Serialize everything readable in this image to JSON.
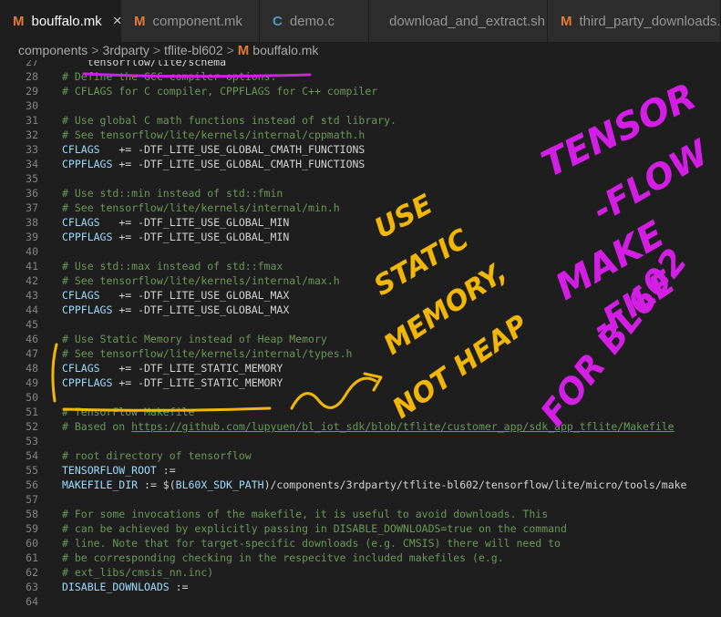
{
  "tabs": [
    {
      "label": "bouffalo.mk",
      "icon": "makefile-icon",
      "active": true
    },
    {
      "label": "component.mk",
      "icon": "makefile-icon"
    },
    {
      "label": "demo.c",
      "icon": "c-file-icon"
    },
    {
      "label": "download_and_extract.sh",
      "icon": "shell-file-icon"
    },
    {
      "label": "third_party_downloads.inc",
      "icon": "makefile-icon"
    }
  ],
  "tab_close": "×",
  "icon_m": "M",
  "icon_c": "C",
  "breadcrumb": {
    "parts": [
      "components",
      "3rdparty",
      "tflite-bl602",
      "bouffalo.mk"
    ],
    "sep": ">"
  },
  "colors": {
    "annotation_purple": "#d41ee6",
    "annotation_yellow": "#f2b705",
    "comment": "#6a9955",
    "variable": "#9cdcfe"
  },
  "code_lines": [
    {
      "n": "27",
      "segs": [
        {
          "t": "    tensorflow/lite/schema",
          "c": "plain"
        }
      ]
    },
    {
      "n": "28",
      "segs": [
        {
          "t": "# Define the GCC compiler options:",
          "c": "comment"
        }
      ]
    },
    {
      "n": "29",
      "segs": [
        {
          "t": "# CFLAGS for C compiler, CPPFLAGS for C++ compiler",
          "c": "comment"
        }
      ]
    },
    {
      "n": "30",
      "segs": []
    },
    {
      "n": "31",
      "segs": [
        {
          "t": "# Use global C math functions instead of std library.",
          "c": "comment"
        }
      ]
    },
    {
      "n": "32",
      "segs": [
        {
          "t": "# See tensorflow/lite/kernels/internal/cppmath.h",
          "c": "comment"
        }
      ]
    },
    {
      "n": "33",
      "segs": [
        {
          "t": "CFLAGS",
          "c": "var"
        },
        {
          "t": "   += -DTF_LITE_USE_GLOBAL_CMATH_FUNCTIONS",
          "c": "plain"
        }
      ]
    },
    {
      "n": "34",
      "segs": [
        {
          "t": "CPPFLAGS",
          "c": "var"
        },
        {
          "t": " += -DTF_LITE_USE_GLOBAL_CMATH_FUNCTIONS",
          "c": "plain"
        }
      ]
    },
    {
      "n": "35",
      "segs": []
    },
    {
      "n": "36",
      "segs": [
        {
          "t": "# Use std::min instead of std::fmin",
          "c": "comment"
        }
      ]
    },
    {
      "n": "37",
      "segs": [
        {
          "t": "# See tensorflow/lite/kernels/internal/min.h",
          "c": "comment"
        }
      ]
    },
    {
      "n": "38",
      "segs": [
        {
          "t": "CFLAGS",
          "c": "var"
        },
        {
          "t": "   += -DTF_LITE_USE_GLOBAL_MIN",
          "c": "plain"
        }
      ]
    },
    {
      "n": "39",
      "segs": [
        {
          "t": "CPPFLAGS",
          "c": "var"
        },
        {
          "t": " += -DTF_LITE_USE_GLOBAL_MIN",
          "c": "plain"
        }
      ]
    },
    {
      "n": "40",
      "segs": []
    },
    {
      "n": "41",
      "segs": [
        {
          "t": "# Use std::max instead of std::fmax",
          "c": "comment"
        }
      ]
    },
    {
      "n": "42",
      "segs": [
        {
          "t": "# See tensorflow/lite/kernels/internal/max.h",
          "c": "comment"
        }
      ]
    },
    {
      "n": "43",
      "segs": [
        {
          "t": "CFLAGS",
          "c": "var"
        },
        {
          "t": "   += -DTF_LITE_USE_GLOBAL_MAX",
          "c": "plain"
        }
      ]
    },
    {
      "n": "44",
      "segs": [
        {
          "t": "CPPFLAGS",
          "c": "var"
        },
        {
          "t": " += -DTF_LITE_USE_GLOBAL_MAX",
          "c": "plain"
        }
      ]
    },
    {
      "n": "45",
      "segs": []
    },
    {
      "n": "46",
      "segs": [
        {
          "t": "# Use Static Memory instead of Heap Memory",
          "c": "comment"
        }
      ]
    },
    {
      "n": "47",
      "segs": [
        {
          "t": "# See tensorflow/lite/kernels/internal/types.h",
          "c": "comment"
        }
      ]
    },
    {
      "n": "48",
      "segs": [
        {
          "t": "CFLAGS",
          "c": "var"
        },
        {
          "t": "   += -DTF_LITE_STATIC_MEMORY",
          "c": "plain"
        }
      ]
    },
    {
      "n": "49",
      "segs": [
        {
          "t": "CPPFLAGS",
          "c": "var"
        },
        {
          "t": " += -DTF_LITE_STATIC_MEMORY",
          "c": "plain"
        }
      ]
    },
    {
      "n": "50",
      "segs": []
    },
    {
      "n": "51",
      "segs": [
        {
          "t": "# TensorFlow Makefile",
          "c": "comment"
        }
      ]
    },
    {
      "n": "52",
      "segs": [
        {
          "t": "# Based on ",
          "c": "comment"
        },
        {
          "t": "https://github.com/lupyuen/bl_iot_sdk/blob/tflite/customer_app/sdk_app_tflite/Makefile",
          "c": "link"
        }
      ]
    },
    {
      "n": "53",
      "segs": []
    },
    {
      "n": "54",
      "segs": [
        {
          "t": "# root directory of tensorflow",
          "c": "comment"
        }
      ]
    },
    {
      "n": "55",
      "segs": [
        {
          "t": "TENSORFLOW_ROOT",
          "c": "var"
        },
        {
          "t": " :=",
          "c": "plain"
        }
      ]
    },
    {
      "n": "56",
      "segs": [
        {
          "t": "MAKEFILE_DIR",
          "c": "var"
        },
        {
          "t": " := $(",
          "c": "plain"
        },
        {
          "t": "BL60X_SDK_PATH",
          "c": "var"
        },
        {
          "t": ")/components/3rdparty/tflite-bl602/tensorflow/lite/micro/tools/make",
          "c": "plain"
        }
      ]
    },
    {
      "n": "57",
      "segs": []
    },
    {
      "n": "58",
      "segs": [
        {
          "t": "# For some invocations of the makefile, it is useful to avoid downloads. This",
          "c": "comment"
        }
      ]
    },
    {
      "n": "59",
      "segs": [
        {
          "t": "# can be achieved by explicitly passing in DISABLE_DOWNLOADS=true on the command",
          "c": "comment"
        }
      ]
    },
    {
      "n": "60",
      "segs": [
        {
          "t": "# line. Note that for target-specific downloads (e.g. CMSIS) there will need to",
          "c": "comment"
        }
      ]
    },
    {
      "n": "61",
      "segs": [
        {
          "t": "# be corresponding checking in the respecitve included makefiles (e.g.",
          "c": "comment"
        }
      ]
    },
    {
      "n": "62",
      "segs": [
        {
          "t": "# ext_libs/cmsis_nn.inc)",
          "c": "comment"
        }
      ]
    },
    {
      "n": "63",
      "segs": [
        {
          "t": "DISABLE_DOWNLOADS",
          "c": "var"
        },
        {
          "t": " :=",
          "c": "plain"
        }
      ]
    },
    {
      "n": "64",
      "segs": []
    }
  ],
  "annotations": {
    "yellow_lines": [
      "USE",
      "STATIC",
      "MEMORY,",
      "NOT HEAP"
    ],
    "purple_lines": [
      "TENSOR",
      "-FLOW",
      "MAKE",
      "-FILE",
      "FOR BL602"
    ]
  }
}
